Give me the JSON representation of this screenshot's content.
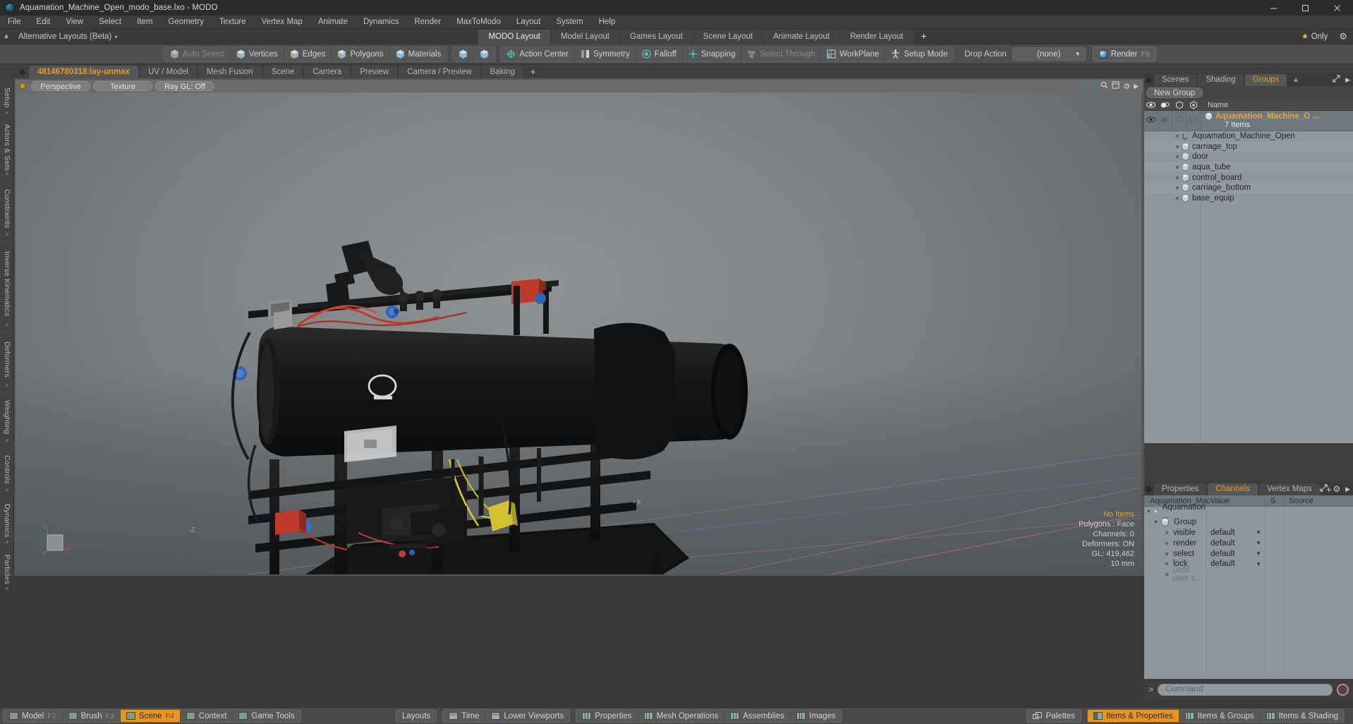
{
  "window": {
    "title": "Aquamation_Machine_Open_modo_base.lxo - MODO",
    "app_icon": "modo-app-icon",
    "minimize": "minimize-icon",
    "maximize": "maximize-icon",
    "close": "close-icon"
  },
  "menubar": {
    "items": [
      {
        "label": "File"
      },
      {
        "label": "Edit"
      },
      {
        "label": "View"
      },
      {
        "label": "Select"
      },
      {
        "label": "Item"
      },
      {
        "label": "Geometry"
      },
      {
        "label": "Texture"
      },
      {
        "label": "Vertex Map"
      },
      {
        "label": "Animate"
      },
      {
        "label": "Dynamics"
      },
      {
        "label": "Render"
      },
      {
        "label": "MaxToModo"
      },
      {
        "label": "Layout"
      },
      {
        "label": "System"
      },
      {
        "label": "Help"
      }
    ]
  },
  "layoutbar": {
    "alt_layouts": "Alternative Layouts (Beta)",
    "caret": "▾",
    "tabs": [
      {
        "label": "MODO Layout",
        "active": true
      },
      {
        "label": "Model Layout",
        "active": false
      },
      {
        "label": "Games Layout",
        "active": false
      },
      {
        "label": "Scene Layout",
        "active": false
      },
      {
        "label": "Animate Layout",
        "active": false
      },
      {
        "label": "Render Layout",
        "active": false
      }
    ],
    "add_tab": "+",
    "only_label": "Only",
    "only_star": "★",
    "settings_icon": "gear-icon"
  },
  "toolbar": {
    "group1": [
      {
        "label": "Auto Select",
        "dimmed": true,
        "icon": "cube-grey-icon"
      },
      {
        "label": "Vertices",
        "dimmed": false,
        "icon": "cube-vertices-icon"
      },
      {
        "label": "Edges",
        "dimmed": false,
        "icon": "cube-edges-icon"
      },
      {
        "label": "Polygons",
        "dimmed": false,
        "icon": "cube-polygons-icon"
      },
      {
        "label": "Materials",
        "dimmed": false,
        "icon": "cube-materials-icon"
      }
    ],
    "group2": [
      {
        "label": "",
        "icon": "cube-items-icon"
      },
      {
        "label": "",
        "icon": "cube-pivot-icon"
      }
    ],
    "group3": [
      {
        "label": "Action Center",
        "dimmed": false,
        "icon": "action-center-icon"
      },
      {
        "label": "Symmetry",
        "dimmed": false,
        "icon": "symmetry-icon"
      },
      {
        "label": "Falloff",
        "dimmed": false,
        "icon": "falloff-icon"
      },
      {
        "label": "Snapping",
        "dimmed": false,
        "icon": "snapping-icon"
      },
      {
        "label": "Select Through",
        "dimmed": true,
        "icon": "select-through-icon"
      },
      {
        "label": "WorkPlane",
        "dimmed": false,
        "icon": "workplane-icon"
      },
      {
        "label": "Setup Mode",
        "dimmed": false,
        "icon": "setup-mode-icon"
      }
    ],
    "drop_action_label": "Drop Action",
    "drop_action_value": "(none)",
    "render_label": "Render",
    "render_shortcut": "F9"
  },
  "viewport_tabs": {
    "tabs": [
      {
        "label": "48146780318:lay-unmax",
        "active": true
      },
      {
        "label": "UV / Model",
        "active": false
      },
      {
        "label": "Mesh Fusion",
        "active": false
      },
      {
        "label": "Scene",
        "active": false
      },
      {
        "label": "Camera",
        "active": false
      },
      {
        "label": "Preview",
        "active": false
      },
      {
        "label": "Camera / Preview",
        "active": false
      },
      {
        "label": "Baking",
        "active": false
      }
    ],
    "add_tab": "+"
  },
  "left_strip": {
    "items": [
      {
        "label": "Setup"
      },
      {
        "label": "Actors & Sets"
      },
      {
        "label": "Constraints"
      },
      {
        "label": "Inverse Kinematics"
      },
      {
        "label": "Deformers"
      },
      {
        "label": "Weighting"
      },
      {
        "label": "Controls"
      },
      {
        "label": "Dynamics"
      },
      {
        "label": "Particles"
      }
    ]
  },
  "viewport": {
    "header": {
      "view_mode": "Perspective",
      "shading_mode": "Texture",
      "raygl": "Ray GL: Off",
      "icons": [
        "move-icon",
        "zoom-icon",
        "search-icon",
        "options-icon",
        "gear-icon",
        "chevron-right-icon"
      ]
    },
    "axis_labels": {
      "plus_x": "+X",
      "minus_z": "-Z"
    },
    "gizmo": {
      "y": "Y",
      "x": "X",
      "z": "Z"
    },
    "stats": {
      "selection": "No Items",
      "polygons": "Polygons : Face",
      "channels": "Channels: 0",
      "deformers": "Deformers: ON",
      "gl": "GL: 419,462",
      "units": "10 mm"
    }
  },
  "right_panel": {
    "tabs": [
      {
        "label": "Scenes",
        "active": false
      },
      {
        "label": "Shading",
        "active": false
      },
      {
        "label": "Groups",
        "active": true
      }
    ],
    "add_tab": "+",
    "new_group_button": "New Group",
    "columns": {
      "eye": "visibility-icon",
      "render": "render-icon",
      "sel1": "selectable-icon",
      "sel2": "lock-icon",
      "name": "Name"
    },
    "group": {
      "name": "Aquamation_Machine_O ...",
      "count": "7 Items",
      "icon": "group-cube-icon"
    },
    "items": [
      {
        "label": "Aquamation_Machine_Open",
        "icon": "locator-axis-icon"
      },
      {
        "label": "carriage_top",
        "icon": "mesh-cube-icon"
      },
      {
        "label": "door",
        "icon": "mesh-cube-icon"
      },
      {
        "label": "aqua_tube",
        "icon": "mesh-cube-icon"
      },
      {
        "label": "control_board",
        "icon": "mesh-cube-icon"
      },
      {
        "label": "carriage_bottom",
        "icon": "mesh-cube-icon"
      },
      {
        "label": "base_equip",
        "icon": "mesh-cube-icon"
      }
    ]
  },
  "lower_panel": {
    "tabs": [
      {
        "label": "Properties",
        "active": false
      },
      {
        "label": "Channels",
        "active": true
      },
      {
        "label": "Vertex Maps",
        "active": false
      }
    ],
    "add_tab": "+",
    "columns": {
      "name": "Aquamation_Mac ...",
      "value": "Value",
      "s": "S",
      "source": "Source"
    },
    "rows": [
      {
        "label": "Aquamation ...",
        "value": "",
        "depth": 0,
        "type": "group-root",
        "icon": "group-cube-icon"
      },
      {
        "label": "Group",
        "value": "",
        "depth": 1,
        "type": "group",
        "icon": "group-cube-icon"
      },
      {
        "label": "visible",
        "value": "default",
        "depth": 2,
        "type": "channel"
      },
      {
        "label": "render",
        "value": "default",
        "depth": 2,
        "type": "channel"
      },
      {
        "label": "select",
        "value": "default",
        "depth": 2,
        "type": "channel"
      },
      {
        "label": "lock",
        "value": "default",
        "depth": 2,
        "type": "channel"
      },
      {
        "label": "(add user c...",
        "value": "",
        "depth": 2,
        "type": "add"
      }
    ]
  },
  "command_bar": {
    "prompt": ">",
    "placeholder": "Command",
    "record_icon": "record-icon"
  },
  "statusbar": {
    "left": [
      {
        "label": "Model",
        "key": "F2",
        "active": false,
        "icon": "viewport-icon"
      },
      {
        "label": "Brush",
        "key": "F3",
        "active": false,
        "icon": "viewport-icon"
      },
      {
        "label": "Scene",
        "key": "F4",
        "active": true,
        "icon": "viewport-icon"
      },
      {
        "label": "Context",
        "key": "",
        "active": false,
        "icon": "viewport-icon"
      },
      {
        "label": "Game Tools",
        "key": "",
        "active": false,
        "icon": "viewport-icon"
      }
    ],
    "center": [
      {
        "label": "Layouts",
        "icon": "",
        "active": false
      },
      {
        "label": "Time",
        "icon": "hbar-icon",
        "active": false
      },
      {
        "label": "Lower Viewports",
        "icon": "hbar-icon",
        "active": false
      },
      {
        "label": "Properties",
        "icon": "split-icon",
        "active": false
      },
      {
        "label": "Mesh Operations",
        "icon": "split-icon",
        "active": false
      },
      {
        "label": "Assemblies",
        "icon": "split-icon",
        "active": false
      },
      {
        "label": "Images",
        "icon": "split-icon",
        "active": false
      }
    ],
    "right": [
      {
        "label": "Palettes",
        "icon": "palettes-icon",
        "active": false
      },
      {
        "label": "Items & Properties",
        "icon": "half-icon",
        "active": true
      },
      {
        "label": "Items & Groups",
        "icon": "split-icon",
        "active": false
      },
      {
        "label": "Items & Shading",
        "icon": "split-icon",
        "active": false
      }
    ]
  },
  "colors": {
    "accent_orange": "#e8941f",
    "tab_orange": "#e89a2c",
    "panel_grey": "#8f979d",
    "toolbar_grey": "#4d4d4d"
  }
}
